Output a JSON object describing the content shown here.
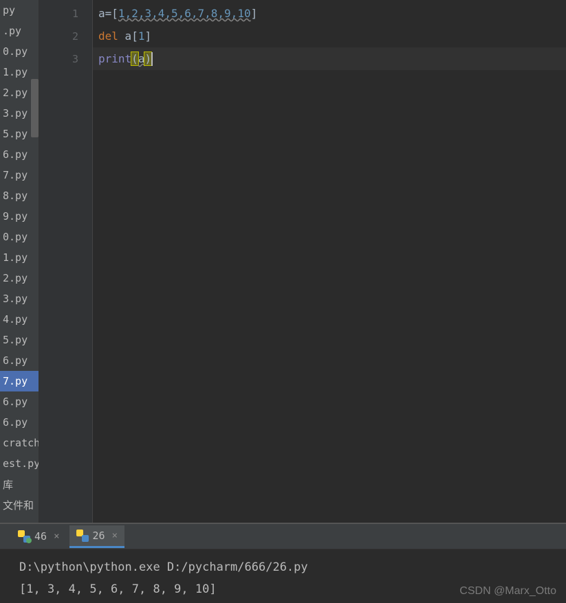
{
  "sidebar": {
    "files": [
      {
        "label": "py",
        "selected": false
      },
      {
        "label": ".py",
        "selected": false
      },
      {
        "label": "0.py",
        "selected": false
      },
      {
        "label": "1.py",
        "selected": false
      },
      {
        "label": "2.py",
        "selected": false
      },
      {
        "label": "3.py",
        "selected": false
      },
      {
        "label": "5.py",
        "selected": false
      },
      {
        "label": "6.py",
        "selected": false
      },
      {
        "label": "7.py",
        "selected": false
      },
      {
        "label": "8.py",
        "selected": false
      },
      {
        "label": "9.py",
        "selected": false
      },
      {
        "label": "0.py",
        "selected": false
      },
      {
        "label": "1.py",
        "selected": false
      },
      {
        "label": "2.py",
        "selected": false
      },
      {
        "label": "3.py",
        "selected": false
      },
      {
        "label": "4.py",
        "selected": false
      },
      {
        "label": "5.py",
        "selected": false
      },
      {
        "label": "6.py",
        "selected": false
      },
      {
        "label": "7.py",
        "selected": true
      },
      {
        "label": "6.py",
        "selected": false
      },
      {
        "label": "6.py",
        "selected": false
      },
      {
        "label": "cratch.p",
        "selected": false
      },
      {
        "label": "est.py",
        "selected": false
      },
      {
        "label": "库",
        "selected": false
      },
      {
        "label": "文件和",
        "selected": false
      }
    ]
  },
  "editor": {
    "line_numbers": [
      "1",
      "2",
      "3"
    ],
    "code": {
      "l1": {
        "var": "a",
        "eq": "=",
        "lb": "[",
        "nums": "1,2,3,4,5,6,7,8,9,10",
        "rb": "]"
      },
      "l2": {
        "kw": "del",
        "sp": " ",
        "var": "a",
        "lb": "[",
        "idx": "1",
        "rb": "]"
      },
      "l3": {
        "fn": "print",
        "lp": "(",
        "arg": "a",
        "rp": ")"
      }
    }
  },
  "run_tabs": [
    {
      "label": "46",
      "active": false
    },
    {
      "label": "26",
      "active": true
    }
  ],
  "console": {
    "line1": "D:\\python\\python.exe D:/pycharm/666/26.py",
    "line2": "[1, 3, 4, 5, 6, 7, 8, 9, 10]"
  },
  "watermark": "CSDN @Marx_Otto"
}
